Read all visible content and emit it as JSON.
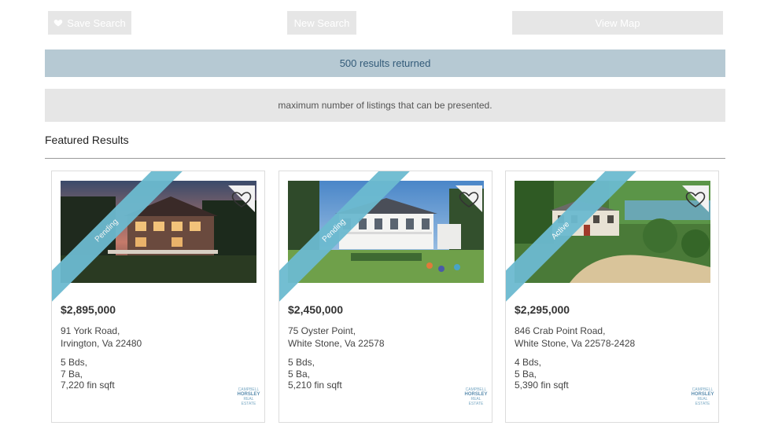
{
  "toolbar": {
    "save_label": "Save Search",
    "new_label": "New Search",
    "map_label": "View Map"
  },
  "results": {
    "text": "500 results returned"
  },
  "notice": {
    "text": "maximum number of listings that can be presented."
  },
  "section": {
    "title": "Featured Results"
  },
  "colors": {
    "ribbon": "#6cbad0",
    "results_bg": "#b6c9d3",
    "results_text": "#335b79",
    "button_bg": "#e6e6e6"
  },
  "listings": [
    {
      "status": "Pending",
      "price": "$2,895,000",
      "address_line1": "91 York Road,",
      "address_line2": "Irvington, Va 22480",
      "beds": "5 Bds,",
      "baths": "7 Ba,",
      "sqft": "7,220 fin sqft",
      "favorite_icon": "heart-outline-icon"
    },
    {
      "status": "Pending",
      "price": "$2,450,000",
      "address_line1": "75 Oyster Point,",
      "address_line2": "White Stone, Va 22578",
      "beds": "5 Bds,",
      "baths": "5 Ba,",
      "sqft": "5,210 fin sqft",
      "favorite_icon": "heart-outline-icon"
    },
    {
      "status": "Active",
      "price": "$2,295,000",
      "address_line1": "846 Crab Point Road,",
      "address_line2": "White Stone, Va 22578-2428",
      "beds": "4 Bds,",
      "baths": "5 Ba,",
      "sqft": "5,390 fin sqft",
      "favorite_icon": "heart-outline-icon"
    }
  ],
  "agency": {
    "line1": "CAMPBELL",
    "line2": "HORSLEY",
    "line3": "REAL ESTATE"
  }
}
